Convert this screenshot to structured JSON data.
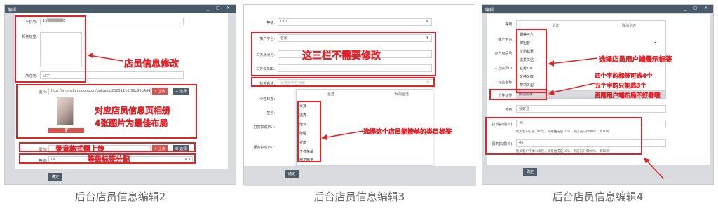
{
  "panels": [
    {
      "title": "编辑",
      "window_controls": "_ ◻ ✕",
      "caption": "后台店员信息编辑2",
      "fields": {
        "phone_label": "手机号:",
        "phone_value": "15▒▒▒▒▒▒5",
        "tags_label": "相关标签:",
        "location_label": "所在地:",
        "location_value": "辽宁",
        "image_label": "图片:",
        "image_url": "http://img.sdlangdong.cn/uploads/20251116/90c93b4d48",
        "upload": "上传",
        "select": "选择",
        "audio_label": "录音:",
        "level_label": "等级:",
        "level_value": "LV.1",
        "confirm": "确定"
      },
      "annotations": {
        "info_edit": "店员信息修改",
        "album_line1": "对应店员信息页相册",
        "album_line2": "4张图片为最佳布局",
        "audio_upload": "录音格式需上传",
        "level_divide": "等级标签分配"
      }
    },
    {
      "title": "",
      "caption": "后台店员信息编辑3",
      "fields": {
        "level_label": "等级:",
        "level_value": "LV.1",
        "platform_label": "推广平台:",
        "platform_value": "音频",
        "third_qq_label": "三方房间号:",
        "third_id_label": "三方会员ID:",
        "tag_name_label": "标签名称:",
        "tag_name_placeholder": "请选择中性标题",
        "personal_tag_label": "个性标签:",
        "select_all": "全选",
        "invert": "反向全选",
        "signature_label": "签名:",
        "reward_label": "打赏抽成(%):",
        "service_label": "服务抽成(%):",
        "confirm": "确定",
        "options": [
          "女技",
          "连麦",
          "陪玩",
          "陪睡",
          "折扇",
          "王者荣耀",
          "和平精英"
        ]
      },
      "annotations": {
        "no_need": "这三栏不需要修改",
        "select_category": "选择这个店员能接单的类目标签"
      }
    },
    {
      "title": "编辑",
      "window_controls": "_ ◻ ✕",
      "caption": "后台店员信息编辑4",
      "fields": {
        "level_label": "等级:",
        "select_all": "全选",
        "invert": "取消全选",
        "platform_label": "推广平台:",
        "third_room_label": "三方房间号:",
        "third_id_label": "三方会员ID:",
        "tag_name_label": "标签名称:",
        "personal_tag_label": "个性标签:",
        "personal_tag_value": "御姐萌妹",
        "signature_label": "签名:",
        "signature_value": "我好哥",
        "reward_label": "打赏抽成(%):",
        "reward_value": "45",
        "reward_note": "比如客户打赏100元，如果抽成是10%，则店员只得90%，即10元",
        "service_label": "服务抽成(%):",
        "service_value": "45",
        "service_note": "比如客户下单100元，如果抽成是10%，则店员只得90%，即10元",
        "confirm": "确定",
        "options": [
          "甜美可人",
          "御姐音",
          "成熟稳重",
          "温柔体贴",
          "直男1v1",
          "又纯又欲",
          "萝莉体型",
          "御姐萌妹"
        ]
      },
      "annotations": {
        "select_tag": "选择店员用户端展示标签",
        "rule_line1": "四个字的标签可选4个",
        "rule_line2": "五个字的只能选3个",
        "rule_line3": "否则用户端布局不好看哦"
      }
    }
  ]
}
